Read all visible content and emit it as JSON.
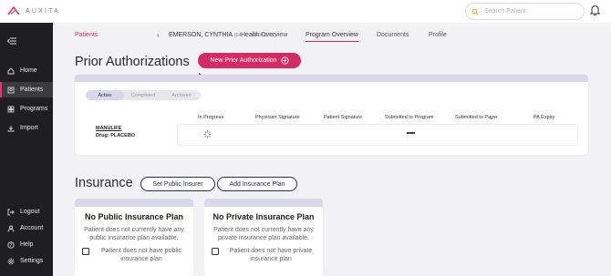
{
  "brand": {
    "name": "AUXITA",
    "accent": "#d42c62",
    "navy": "#2d2a5e"
  },
  "search": {
    "placeholder": "Search Patient",
    "icon": "search-icon"
  },
  "sidebar": {
    "items": [
      {
        "label": "Home",
        "icon": "home-icon"
      },
      {
        "label": "Patients",
        "icon": "patients-icon",
        "active": true
      },
      {
        "label": "Programs",
        "icon": "programs-icon"
      },
      {
        "label": "Import",
        "icon": "import-icon"
      }
    ],
    "bottom_items": [
      {
        "label": "Logout",
        "icon": "logout-icon"
      },
      {
        "label": "Account",
        "icon": "account-icon"
      },
      {
        "label": "Help",
        "icon": "help-icon"
      },
      {
        "label": "Settings",
        "icon": "settings-icon"
      }
    ]
  },
  "breadcrumb": {
    "parent": "Patients",
    "patient_name": "EMERSON, CYNTHIA",
    "patient_meta": "(64, F, 1960/02/12)"
  },
  "tabs": [
    {
      "label": "Health Overview"
    },
    {
      "label": "Program Overview",
      "active": true
    },
    {
      "label": "Documents"
    },
    {
      "label": "Profile"
    }
  ],
  "prior_auth": {
    "title": "Prior Authorizations",
    "new_button": "New Prior Authorization",
    "filters": [
      "Active",
      "Completed",
      "Archived"
    ],
    "active_filter": "Active",
    "columns": [
      "In Progress",
      "Physician Signature",
      "Patient Signature",
      "Submitted to Program",
      "Submitted to Payer",
      "PA Expiry"
    ],
    "rows": [
      {
        "insurer": "MANULIFE",
        "drug": "Drug: PLACEBO",
        "submitted_to_program": "—"
      }
    ]
  },
  "insurance": {
    "title": "Insurance",
    "set_public_button": "Set Public Insurer",
    "add_plan_button": "Add Insurance Plan",
    "public": {
      "title": "No Public Insurance Plan",
      "text": "Patient does not currently have any public insurance plan available.",
      "checkbox_label": "Patient does not have public insurance plan"
    },
    "private": {
      "title": "No Private Insurance Plan",
      "text": "Patient does not currently have any private insurance plan available.",
      "checkbox_label": "Patient does not have private insurance plan"
    }
  }
}
